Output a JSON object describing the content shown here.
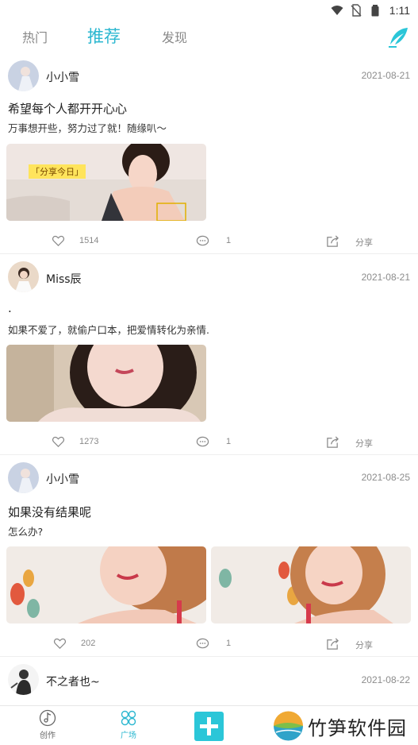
{
  "status_bar": {
    "time": "1:11"
  },
  "top_tabs": [
    "热门",
    "推荐",
    "发现"
  ],
  "posts": [
    {
      "username": "小小雪",
      "date": "2021-08-21",
      "title": "希望每个人都开开心心",
      "text": "万事想开些，努力过了就！随缘叭～",
      "image_caption": "「分享今日」",
      "likes": "1514",
      "comments": "1",
      "share": "分享"
    },
    {
      "username": "Miss辰",
      "date": "2021-08-21",
      "title": ".",
      "text": "如果不爱了，就偷户口本，把爱情转化为亲情.",
      "likes": "1273",
      "comments": "1",
      "share": "分享"
    },
    {
      "username": "小小雪",
      "date": "2021-08-25",
      "title": "如果没有结果呢",
      "text": "怎么办?",
      "likes": "202",
      "comments": "1",
      "share": "分享"
    },
    {
      "username": "不之者也~",
      "date": "2021-08-22"
    }
  ],
  "bottom_nav": [
    {
      "label": "创作",
      "icon": "music-note-icon"
    },
    {
      "label": "广场",
      "icon": "clover-icon"
    },
    {
      "label": "",
      "icon": "plus-icon"
    }
  ],
  "watermark": "竹笋软件园",
  "colors": {
    "accent": "#2bb7d0",
    "plus": "#2bc6d8"
  }
}
